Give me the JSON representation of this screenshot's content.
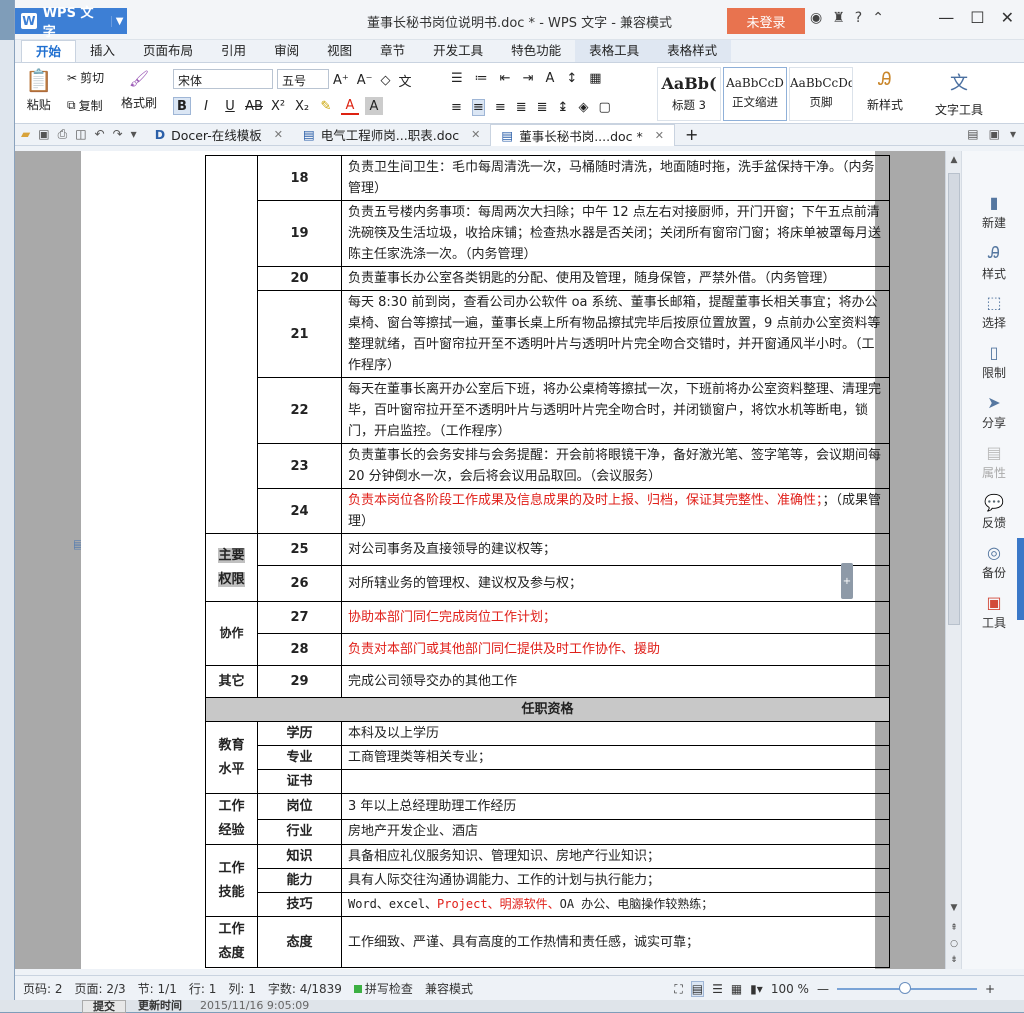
{
  "app": {
    "name": "WPS 文字",
    "title": "董事长秘书岗位说明书.doc * - WPS 文字 - 兼容模式",
    "login": "未登录"
  },
  "menu": [
    "开始",
    "插入",
    "页面布局",
    "引用",
    "审阅",
    "视图",
    "章节",
    "开发工具",
    "特色功能",
    "表格工具",
    "表格样式"
  ],
  "ribbon": {
    "paste": "粘贴",
    "cut": "剪切",
    "copy": "复制",
    "format_painter": "格式刷",
    "font": "宋体",
    "size": "五号",
    "styles": [
      {
        "preview": "AaBb(",
        "label": "标题 3"
      },
      {
        "preview": "AaBbCcD",
        "label": "正文缩进"
      },
      {
        "preview": "AaBbCcDd",
        "label": "页脚"
      }
    ],
    "new_style": "新样式",
    "text_tools": "文字工具"
  },
  "tabs": [
    {
      "label": "Docer-在线模板"
    },
    {
      "label": "电气工程师岗...职表.doc"
    },
    {
      "label": "董事长秘书岗....doc *"
    }
  ],
  "right_panel": [
    {
      "label": "新建"
    },
    {
      "label": "样式"
    },
    {
      "label": "选择"
    },
    {
      "label": "限制"
    },
    {
      "label": "分享"
    },
    {
      "label": "属性"
    },
    {
      "label": "反馈"
    },
    {
      "label": "备份"
    },
    {
      "label": "工具"
    }
  ],
  "duties": [
    {
      "n": "18",
      "text": "负责卫生间卫生：毛巾每周清洗一次，马桶随时清洗，地面随时拖，洗手盆保持干净。（内务管理）"
    },
    {
      "n": "19",
      "text": "负责五号楼内务事项：每周两次大扫除；中午 12 点左右对接厨师，开门开窗；下午五点前清洗碗筷及生活垃圾，收拾床铺；检查热水器是否关闭；关闭所有窗帘门窗；将床单被罩每月送陈主任家洗涤一次。（内务管理）"
    },
    {
      "n": "20",
      "text": "负责董事长办公室各类钥匙的分配、使用及管理，随身保管，严禁外借。（内务管理）"
    },
    {
      "n": "21",
      "text": "每天 8:30 前到岗，查看公司办公软件 oa 系统、董事长邮箱，提醒董事长相关事宜；将办公桌椅、窗台等擦拭一遍，董事长桌上所有物品擦拭完毕后按原位置放置，9 点前办公室资料等整理就绪，百叶窗帘拉开至不透明叶片与透明叶片完全吻合交错时，并开窗通风半小时。（工作程序）"
    },
    {
      "n": "22",
      "text": "每天在董事长离开办公室后下班，将办公桌椅等擦拭一次，下班前将办公室资料整理、清理完毕，百叶窗帘拉开至不透明叶片与透明叶片完全吻合时，并闭锁窗户，将饮水机等断电，锁门，开启监控。（工作程序）"
    },
    {
      "n": "23",
      "text": "负责董事长的会务安排与会务提醒：开会前将眼镜干净，备好激光笔、签字笔等，会议期间每 20 分钟倒水一次，会后将会议用品取回。（会议服务）"
    },
    {
      "n": "24",
      "text_red": "负责本岗位各阶段工作成果及信息成果的及时上报、归档，保证其完整性、准确性；",
      "text": "；（成果管理）"
    }
  ],
  "authority": {
    "label1": "主要",
    "label2": "权限",
    "rows": [
      {
        "n": "25",
        "text": "对公司事务及直接领导的建议权等；"
      },
      {
        "n": "26",
        "text": "对所辖业务的管理权、建议权及参与权；"
      }
    ]
  },
  "cooperation": {
    "label": "协作",
    "rows": [
      {
        "n": "27",
        "text": "协助本部门同仁完成岗位工作计划；"
      },
      {
        "n": "28",
        "text": "负责对本部门或其他部门同仁提供及时工作协作、援助"
      }
    ]
  },
  "other": {
    "label": "其它",
    "n": "29",
    "text": "完成公司领导交办的其他工作"
  },
  "qualifications": {
    "header": "任职资格",
    "education": {
      "l1": "教育",
      "l2": "水平",
      "rows": [
        {
          "k": "学历",
          "v": "本科及以上学历"
        },
        {
          "k": "专业",
          "v": "工商管理类等相关专业；"
        },
        {
          "k": "证书",
          "v": ""
        }
      ]
    },
    "experience": {
      "l1": "工作",
      "l2": "经验",
      "rows": [
        {
          "k": "岗位",
          "v": "3 年以上总经理助理工作经历"
        },
        {
          "k": "行业",
          "v": "房地产开发企业、酒店"
        }
      ]
    },
    "skills": {
      "l1": "工作",
      "l2": "技能",
      "rows": [
        {
          "k": "知识",
          "v": "具备相应礼仪服务知识、管理知识、房地产行业知识；"
        },
        {
          "k": "能力",
          "v": "具有人际交往沟通协调能力、工作的计划与执行能力；"
        },
        {
          "k": "技巧",
          "v_a": "Word、excel、",
          "v_red": "Project、明源软件、",
          "v_b": "OA 办公、电脑操作较熟练；"
        }
      ]
    },
    "attitude": {
      "l1": "工作",
      "l2": "态度",
      "k": "态度",
      "v": "工作细致、严谨、具有高度的工作热情和责任感，诚实可靠；"
    }
  },
  "status": {
    "page_code": "页码: 2",
    "pages": "页面: 2/3",
    "section": "节: 1/1",
    "row": "行: 1",
    "col": "列: 1",
    "words": "字数: 4/1839",
    "spell": "拼写检查",
    "mode": "兼容模式",
    "zoom": "100 %"
  },
  "bottom": {
    "submit": "提交",
    "update_label": "更新时间",
    "update_time": "2015/11/16 9:05:09"
  }
}
